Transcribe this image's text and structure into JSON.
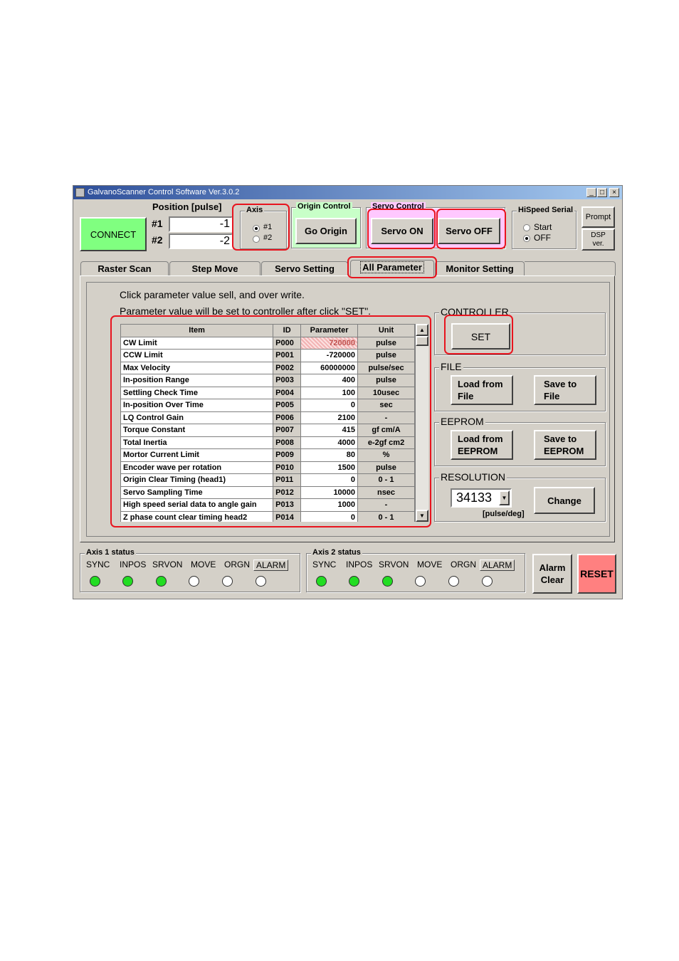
{
  "window": {
    "title": "GalvanoScanner Control Software Ver.3.0.2",
    "controls": [
      "_",
      "□",
      "×"
    ]
  },
  "top": {
    "connect_label": "CONNECT",
    "position_label": "Position [pulse]",
    "pos1_label": "#1",
    "pos1_value": "-1",
    "pos2_label": "#2",
    "pos2_value": "-2",
    "axis": {
      "label": "Axis",
      "opt1": "#1",
      "opt2": "#2",
      "selected": "#1"
    },
    "origin": {
      "label": "Origin Control",
      "button": "Go Origin",
      "color": "#c8ffc8"
    },
    "servo": {
      "label": "Servo Control",
      "on": "Servo ON",
      "off": "Servo OFF",
      "color": "#ffc8ff"
    },
    "hispeed": {
      "label": "HiSpeed Serial",
      "start": "Start",
      "off": "OFF",
      "selected": "OFF"
    },
    "prompt": "Prompt",
    "dsp_line1": "DSP",
    "dsp_line2": "ver."
  },
  "tabs": [
    "Raster Scan",
    "Step Move",
    "Servo Setting",
    "All Parameter",
    "Monitor Setting"
  ],
  "active_tab": "All Parameter",
  "panel": {
    "instruction1": "Click parameter value sell, and over write.",
    "instruction2": "Parameter value will be set to controller after click \"SET\".",
    "table": {
      "headers": [
        "Item",
        "ID",
        "Parameter",
        "Unit"
      ],
      "rows": [
        [
          "CW Limit",
          "P000",
          "720000",
          "pulse"
        ],
        [
          "CCW Limit",
          "P001",
          "-720000",
          "pulse"
        ],
        [
          "Max Velocity",
          "P002",
          "60000000",
          "pulse/sec"
        ],
        [
          "In-position Range",
          "P003",
          "400",
          "pulse"
        ],
        [
          "Settling Check Time",
          "P004",
          "100",
          "10usec"
        ],
        [
          "In-position Over Time",
          "P005",
          "0",
          "sec"
        ],
        [
          "LQ Control Gain",
          "P006",
          "2100",
          "-"
        ],
        [
          "Torque Constant",
          "P007",
          "415",
          "gf cm/A"
        ],
        [
          "Total Inertia",
          "P008",
          "4000",
          "e-2gf cm2"
        ],
        [
          "Mortor Current Limit",
          "P009",
          "80",
          "%"
        ],
        [
          "Encoder wave per rotation",
          "P010",
          "1500",
          "pulse"
        ],
        [
          "Origin Clear Timing (head1)",
          "P011",
          "0",
          "0 - 1"
        ],
        [
          "Servo Sampling Time",
          "P012",
          "10000",
          "nsec"
        ],
        [
          "High speed serial data to angle gain",
          "P013",
          "1000",
          "-"
        ],
        [
          "Z phase count clear timing head2",
          "P014",
          "0",
          "0 - 1"
        ]
      ]
    },
    "controller": {
      "label": "CONTROLLER",
      "set": "SET"
    },
    "file": {
      "label": "FILE",
      "load": [
        "Load from",
        "File"
      ],
      "save": [
        "Save to",
        "File"
      ]
    },
    "eeprom": {
      "label": "EEPROM",
      "load": [
        "Load from",
        "EEPROM"
      ],
      "save": [
        "Save to",
        "EEPROM"
      ]
    },
    "resolution": {
      "label": "RESOLUTION",
      "value": "34133",
      "unit": "[pulse/deg]",
      "change": "Change"
    }
  },
  "status": {
    "axis1": {
      "label": "Axis 1 status",
      "leds": [
        "SYNC",
        "INPOS",
        "SRVON",
        "MOVE",
        "ORGN",
        "ALARM"
      ],
      "states": [
        true,
        true,
        true,
        false,
        false,
        false
      ]
    },
    "axis2": {
      "label": "Axis 2 status",
      "leds": [
        "SYNC",
        "INPOS",
        "SRVON",
        "MOVE",
        "ORGN",
        "ALARM"
      ],
      "states": [
        true,
        true,
        true,
        false,
        false,
        false
      ]
    },
    "led_on_color": "#22dd22",
    "led_off_color": "#ffffff"
  },
  "alarm_clear": [
    "Alarm",
    "Clear"
  ],
  "reset": {
    "label": "RESET",
    "color": "#ff8080"
  },
  "highlight_color": "#e8141e"
}
